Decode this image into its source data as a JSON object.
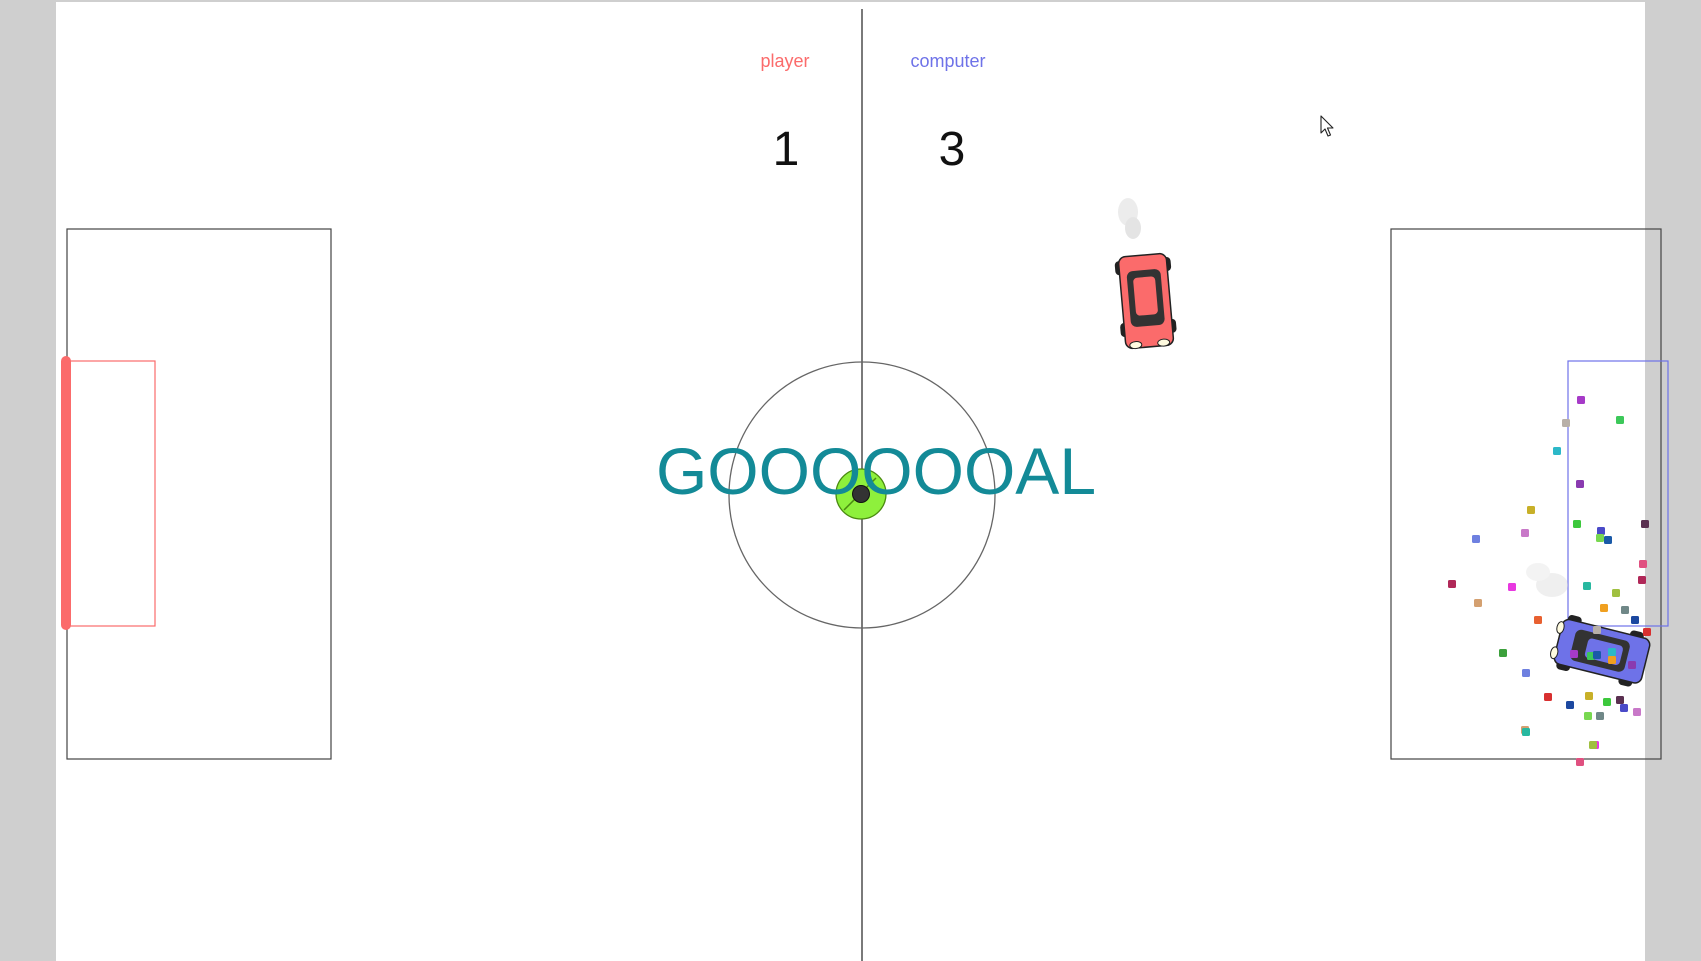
{
  "scoreboard": {
    "player_label": "player",
    "computer_label": "computer",
    "player_score": "1",
    "computer_score": "3"
  },
  "banner": {
    "text": "GOOOOOOAL"
  },
  "colors": {
    "player": "#fb6b6b",
    "computer": "#6e72e8",
    "ball": "#8ef03c",
    "goal_text": "#138a97",
    "field": "#ffffff",
    "outside": "#cfcfcf"
  },
  "confetti_colors": [
    "#a63ac8",
    "#3cc85a",
    "#b8b0a8",
    "#2cb8c8",
    "#8a3ab0",
    "#c8b028",
    "#3cc83c",
    "#4a4ac8",
    "#c878c8",
    "#78d850",
    "#6e80e0",
    "#1a5aa8",
    "#5a3050",
    "#b02858",
    "#d4a070",
    "#e838e0",
    "#28b8a0",
    "#e05080",
    "#a0c040",
    "#708888",
    "#f0a020",
    "#1c48a0",
    "#d83030",
    "#e86030",
    "#3ca03c"
  ],
  "cursor_icon": "arrow-cursor-icon"
}
